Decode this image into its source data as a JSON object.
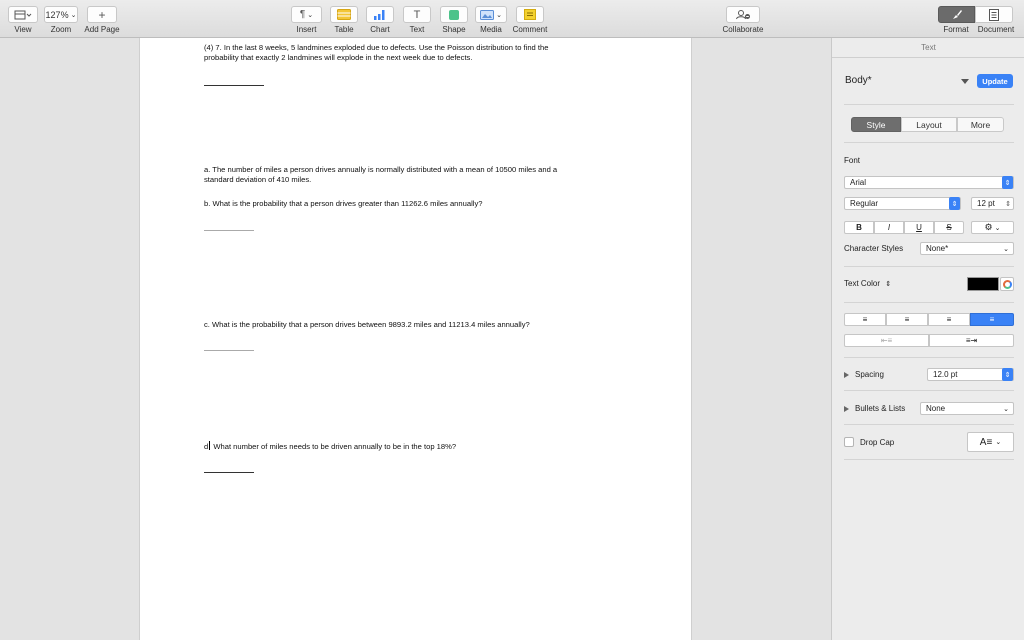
{
  "toolbar": {
    "view_label": "View",
    "zoom_value": "127%",
    "zoom_label": "Zoom",
    "add_page_label": "Add Page",
    "insert_label": "Insert",
    "table_label": "Table",
    "chart_label": "Chart",
    "text_label": "Text",
    "shape_label": "Shape",
    "media_label": "Media",
    "comment_label": "Comment",
    "collaborate_label": "Collaborate",
    "format_label": "Format",
    "document_label": "Document",
    "accent_color": "#3a82f6"
  },
  "document": {
    "q4_line1": "(4) 7. In the last 8 weeks, 5 landmines exploded due to defects. Use the Poisson distribution to find the",
    "q4_line2": "probability that exactly 2 landmines will explode in the next week due to defects.",
    "qa_line1": "a. The number of miles a person drives annually is normally distributed with a mean of 10500 miles and a",
    "qa_line2": "standard deviation of 410 miles.",
    "qb": "b. What is the probability that a person drives greater than 11262.6 miles annually?",
    "qc": "c. What is the probability that a person drives between 9893.2 miles and 11213.4 miles annually?",
    "qd_prefix": "d",
    "qd_rest": " What number of miles needs to be driven annually to be in the top 18%?"
  },
  "inspector": {
    "header": "Text",
    "paragraph_style": "Body*",
    "update_label": "Update",
    "tabs": [
      "Style",
      "Layout",
      "More"
    ],
    "font_section": "Font",
    "font_family": "Arial",
    "font_weight": "Regular",
    "font_size": "12 pt",
    "bold": "B",
    "italic": "I",
    "underline": "U",
    "strike": "S",
    "char_styles_label": "Character Styles",
    "char_styles_value": "None*",
    "text_color_label": "Text Color",
    "text_color_value": "#000000",
    "spacing_label": "Spacing",
    "spacing_value": "12.0 pt",
    "bullets_label": "Bullets & Lists",
    "bullets_value": "None",
    "drop_cap_label": "Drop Cap",
    "drop_cap_checked": false
  }
}
